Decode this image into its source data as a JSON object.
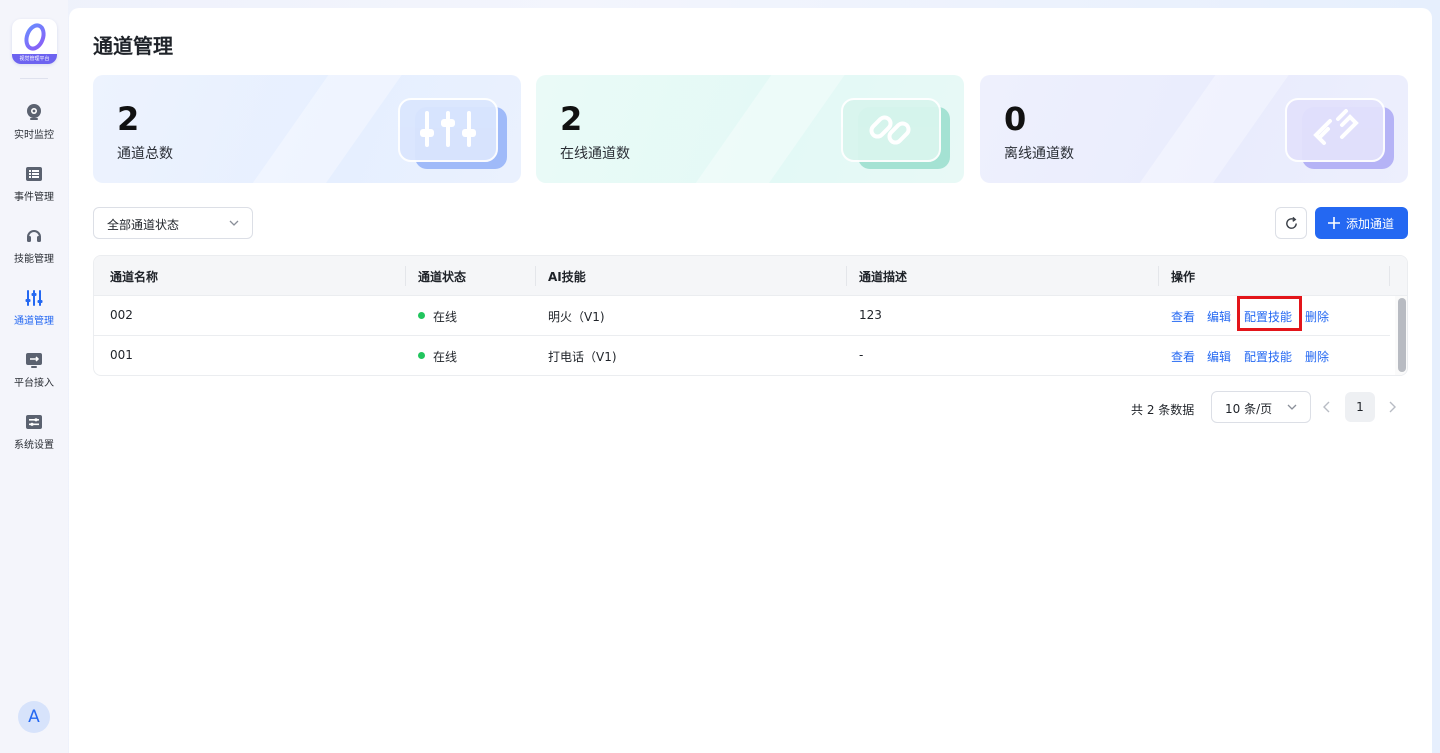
{
  "app": {
    "logo_caption": "视觉管理平台"
  },
  "sidebar": {
    "items": [
      {
        "label": "实时监控",
        "icon": "monitor-eye-icon"
      },
      {
        "label": "事件管理",
        "icon": "event-list-icon"
      },
      {
        "label": "技能管理",
        "icon": "headset-icon"
      },
      {
        "label": "通道管理",
        "icon": "sliders-icon",
        "active": true
      },
      {
        "label": "平台接入",
        "icon": "platform-link-icon"
      },
      {
        "label": "系统设置",
        "icon": "settings-panel-icon"
      }
    ],
    "avatar": "A"
  },
  "page": {
    "title": "通道管理"
  },
  "stats": [
    {
      "value": "2",
      "label": "通道总数",
      "icon": "sliders-icon"
    },
    {
      "value": "2",
      "label": "在线通道数",
      "icon": "link-icon"
    },
    {
      "value": "0",
      "label": "离线通道数",
      "icon": "unlink-icon"
    }
  ],
  "toolbar": {
    "status_filter": "全部通道状态",
    "add_label": "添加通道"
  },
  "table": {
    "headers": [
      "通道名称",
      "通道状态",
      "AI技能",
      "通道描述",
      "操作"
    ],
    "rows": [
      {
        "name": "002",
        "status": "在线",
        "skill": "明火（V1)",
        "desc": "123"
      },
      {
        "name": "001",
        "status": "在线",
        "skill": "打电话（V1)",
        "desc": "-"
      }
    ],
    "actions": [
      "查看",
      "编辑",
      "配置技能",
      "删除"
    ]
  },
  "pagination": {
    "total_text": "共 2 条数据",
    "page_size": "10 条/页",
    "current_page": "1"
  },
  "colors": {
    "primary": "#2468f2",
    "online": "#22c55e",
    "highlight": "#e3151a"
  }
}
